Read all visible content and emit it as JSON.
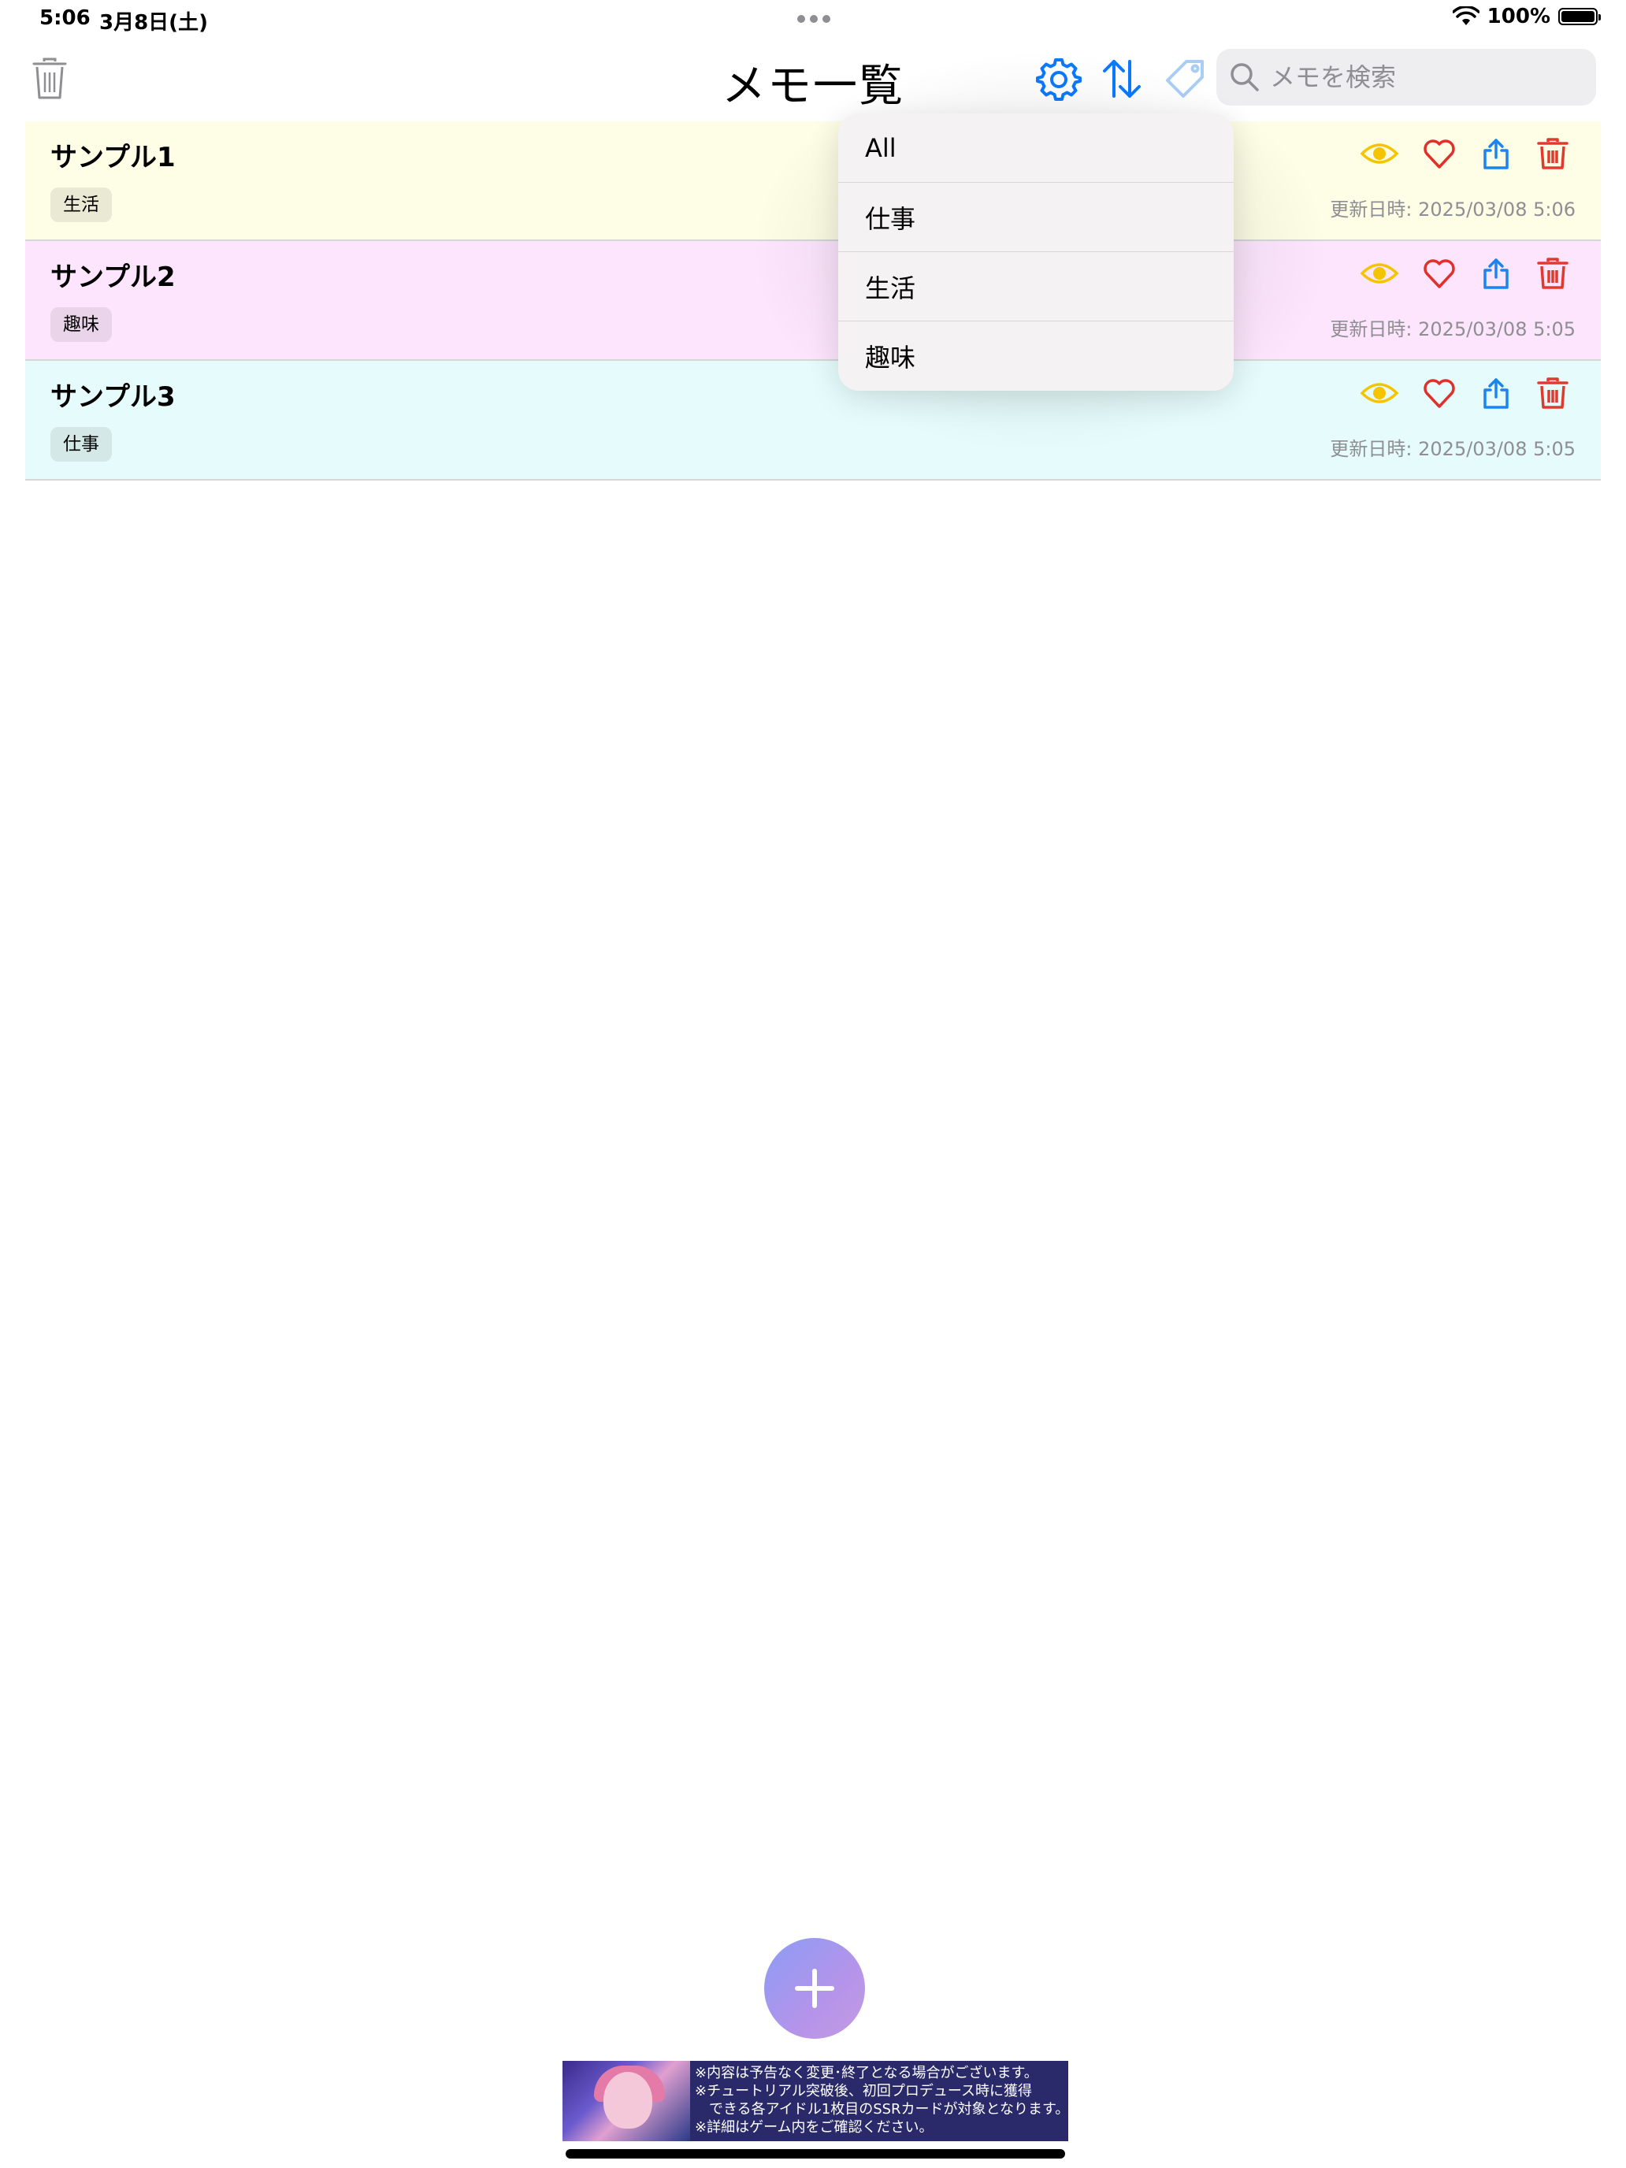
{
  "status_bar": {
    "time": "5:06",
    "date": "3月8日(土)",
    "battery": "100%"
  },
  "nav": {
    "title": "メモ一覧",
    "search_placeholder": "メモを検索"
  },
  "memos": [
    {
      "title": "サンプル1",
      "tag": "生活",
      "updated": "更新日時: 2025/03/08 5:06",
      "bg": "#fefee6"
    },
    {
      "title": "サンプル2",
      "tag": "趣味",
      "updated": "更新日時: 2025/03/08 5:05",
      "bg": "#fde6fd"
    },
    {
      "title": "サンプル3",
      "tag": "仕事",
      "updated": "更新日時: 2025/03/08 5:05",
      "bg": "#e6fcfc"
    }
  ],
  "dropdown": {
    "items": [
      "All",
      "仕事",
      "生活",
      "趣味"
    ]
  },
  "ad": {
    "lines": [
      "※内容は予告なく変更･終了となる場合がございます。",
      "※チュートリアル突破後、初回プロデュース時に獲得",
      "　できる各アイドル1枚目のSSRカードが対象となります。",
      "※詳細はゲーム内をご確認ください。"
    ]
  },
  "colors": {
    "accent": "#0a7aff",
    "eye": "#f5c400",
    "heart": "#e0302a",
    "share": "#1a84f0",
    "trash": "#e03a2e"
  }
}
